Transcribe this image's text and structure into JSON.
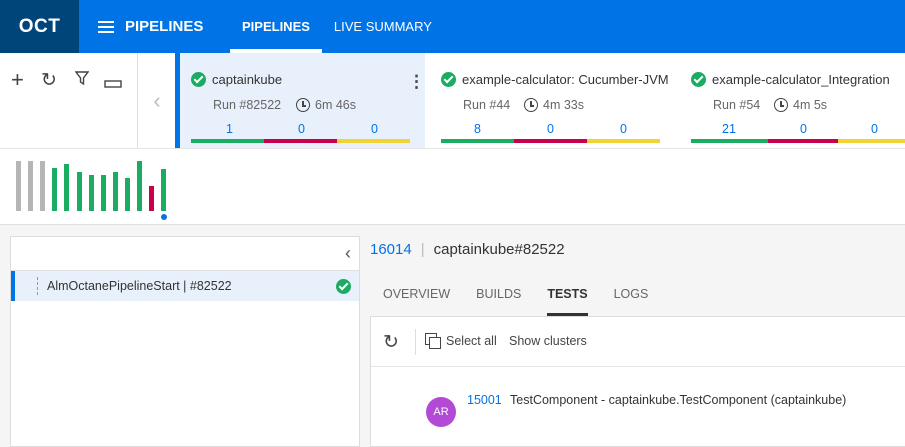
{
  "app": {
    "logo": "OCT",
    "module": "PIPELINES"
  },
  "top_tabs": [
    {
      "label": "PIPELINES",
      "active": true
    },
    {
      "label": "LIVE SUMMARY",
      "active": false
    }
  ],
  "toolbar": {
    "icons": [
      "add-icon",
      "refresh-icon",
      "filter-icon",
      "minimize-icon"
    ]
  },
  "pipelines": [
    {
      "name": "captainkube",
      "run": "Run #82522",
      "duration": "6m 46s",
      "passed": "1",
      "failed": "0",
      "skipped": "0",
      "status": "success"
    },
    {
      "name": "example-calculator: Cucumber-JVM",
      "run": "Run #44",
      "duration": "4m 33s",
      "passed": "8",
      "failed": "0",
      "skipped": "0",
      "status": "success"
    },
    {
      "name": "example-calculator_Integration",
      "run": "Run #54",
      "duration": "4m 5s",
      "passed": "21",
      "failed": "0",
      "skipped": "0",
      "status": "success"
    }
  ],
  "colors": {
    "accent": "#0073e7",
    "dark": "#00457a",
    "pass": "#1aac60",
    "fail": "#c9004b",
    "skip": "#f2d335",
    "grey": "#b5b5b5"
  },
  "run_history": [
    "grey",
    "grey",
    "grey",
    "pass",
    "pass",
    "pass",
    "pass",
    "pass",
    "pass",
    "pass",
    "pass",
    "fail",
    "pass"
  ],
  "left_panel": {
    "item": "AlmOctanePipelineStart | #82522"
  },
  "detail": {
    "id": "16014",
    "title": "captainkube#82522",
    "tabs": [
      {
        "label": "OVERVIEW",
        "active": false
      },
      {
        "label": "BUILDS",
        "active": false
      },
      {
        "label": "TESTS",
        "active": true
      },
      {
        "label": "LOGS",
        "active": false
      }
    ]
  },
  "tests": {
    "select_all": "Select all",
    "show_clusters": "Show clusters",
    "rows": [
      {
        "avatar": "AR",
        "id": "15001",
        "name": "TestComponent - captainkube.TestComponent (captainkube)"
      }
    ]
  }
}
